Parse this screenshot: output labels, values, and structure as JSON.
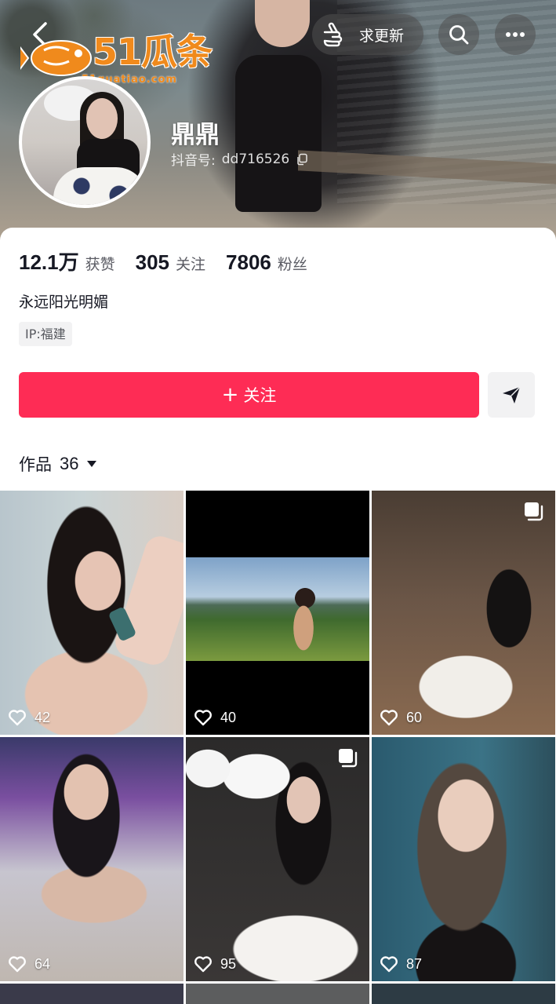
{
  "header": {
    "back_icon": "chevron-left-icon",
    "watermark": {
      "logo": "51瓜条",
      "url": "51guatiao.com"
    },
    "request_update_label": "求更新",
    "search_icon": "search-icon",
    "more_icon": "more-horizontal-icon"
  },
  "profile": {
    "nickname": "鼎鼎",
    "id_label": "抖音号:",
    "id_value": "dd716526",
    "copy_icon": "copy-icon"
  },
  "stats": [
    {
      "value": "12.1万",
      "label": "获赞"
    },
    {
      "value": "305",
      "label": "关注"
    },
    {
      "value": "7806",
      "label": "粉丝"
    }
  ],
  "bio": "永远阳光明媚",
  "ip_tag": "IP:福建",
  "actions": {
    "follow_label": "关注",
    "follow_plus": "+",
    "share_icon": "send-icon"
  },
  "works_tab": {
    "label": "作品",
    "count": "36"
  },
  "videos": [
    {
      "likes": "42",
      "multi": false
    },
    {
      "likes": "40",
      "multi": false
    },
    {
      "likes": "60",
      "multi": true
    },
    {
      "likes": "64",
      "multi": false
    },
    {
      "likes": "95",
      "multi": true
    },
    {
      "likes": "87",
      "multi": false
    }
  ],
  "colors": {
    "primary": "#fe2c55",
    "text": "#161823",
    "secondary_text": "#5a5b63",
    "tag_bg": "#f2f2f3"
  }
}
